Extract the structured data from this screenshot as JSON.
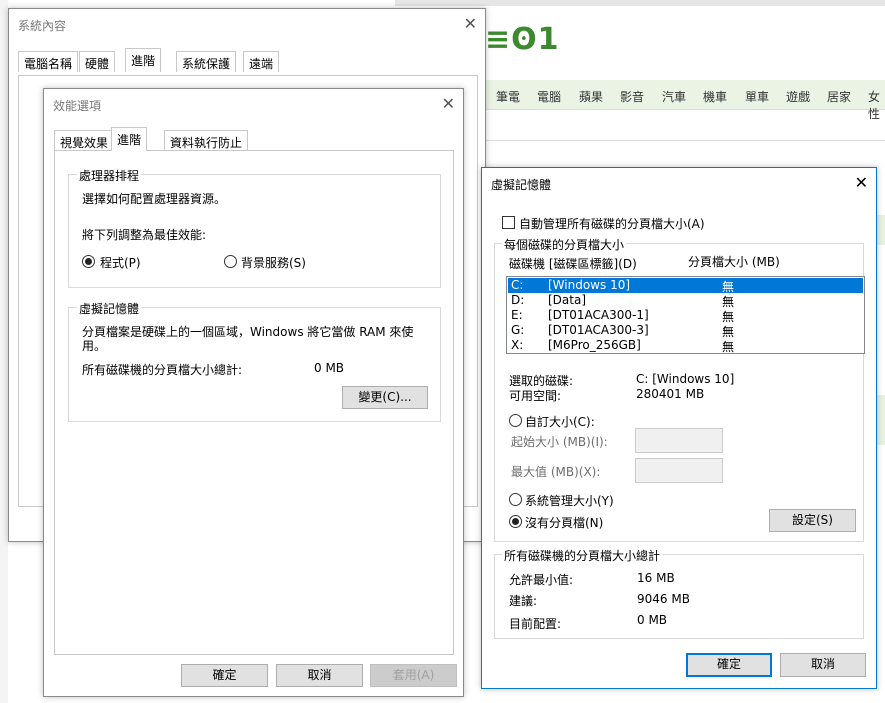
{
  "background": {
    "nav_items": [
      "筆電",
      "電腦",
      "蘋果",
      "影音",
      "汽車",
      "機車",
      "單車",
      "遊戲",
      "居家",
      "女性"
    ]
  },
  "system_properties": {
    "title": "系統內容",
    "tabs": [
      "電腦名稱",
      "硬體",
      "進階",
      "系統保護",
      "遠端"
    ]
  },
  "performance_options": {
    "title": "效能選項",
    "tabs": [
      "視覺效果",
      "進階",
      "資料執行防止"
    ],
    "processor_group": {
      "label": "處理器排程",
      "desc": "選擇如何配置處理器資源。",
      "adjust_label": "將下列調整為最佳效能:",
      "option_programs": "程式(P)",
      "option_background": "背景服務(S)"
    },
    "vm_group": {
      "label": "虛擬記憶體",
      "desc_line1": "分頁檔案是硬碟上的一個區域，Windows 將它當做 RAM 來使",
      "desc_line2": "用。",
      "total_label": "所有磁碟機的分頁檔大小總計:",
      "total_value": "0 MB",
      "change_button": "變更(C)..."
    },
    "buttons": {
      "ok": "確定",
      "cancel": "取消",
      "apply": "套用(A)"
    }
  },
  "virtual_memory": {
    "title": "虛擬記憶體",
    "auto_manage": "自動管理所有磁碟的分頁檔大小(A)",
    "per_drive_label": "每個磁碟的分頁檔大小",
    "col_drive": "磁碟機 [磁碟區標籤](D)",
    "col_size": "分頁檔大小 (MB)",
    "drives": [
      {
        "letter": "C:",
        "label": "[Windows 10]",
        "size": "無"
      },
      {
        "letter": "D:",
        "label": "[Data]",
        "size": "無"
      },
      {
        "letter": "E:",
        "label": "[DT01ACA300-1]",
        "size": "無"
      },
      {
        "letter": "G:",
        "label": "[DT01ACA300-3]",
        "size": "無"
      },
      {
        "letter": "X:",
        "label": "[M6Pro_256GB]",
        "size": "無"
      }
    ],
    "selected_drive_label": "選取的磁碟:",
    "selected_drive_value": "C:  [Windows 10]",
    "free_space_label": "可用空間:",
    "free_space_value": "280401 MB",
    "custom_size": "自訂大小(C):",
    "initial_size": "起始大小 (MB)(I):",
    "max_size": "最大值 (MB)(X):",
    "system_managed": "系統管理大小(Y)",
    "no_paging": "沒有分頁檔(N)",
    "set_button": "設定(S)",
    "totals_label": "所有磁碟機的分頁檔大小總計",
    "min_allowed_label": "允許最小值:",
    "min_allowed_value": "16 MB",
    "recommended_label": "建議:",
    "recommended_value": "9046 MB",
    "current_label": "目前配置:",
    "current_value": "0 MB",
    "ok": "確定",
    "cancel": "取消"
  }
}
